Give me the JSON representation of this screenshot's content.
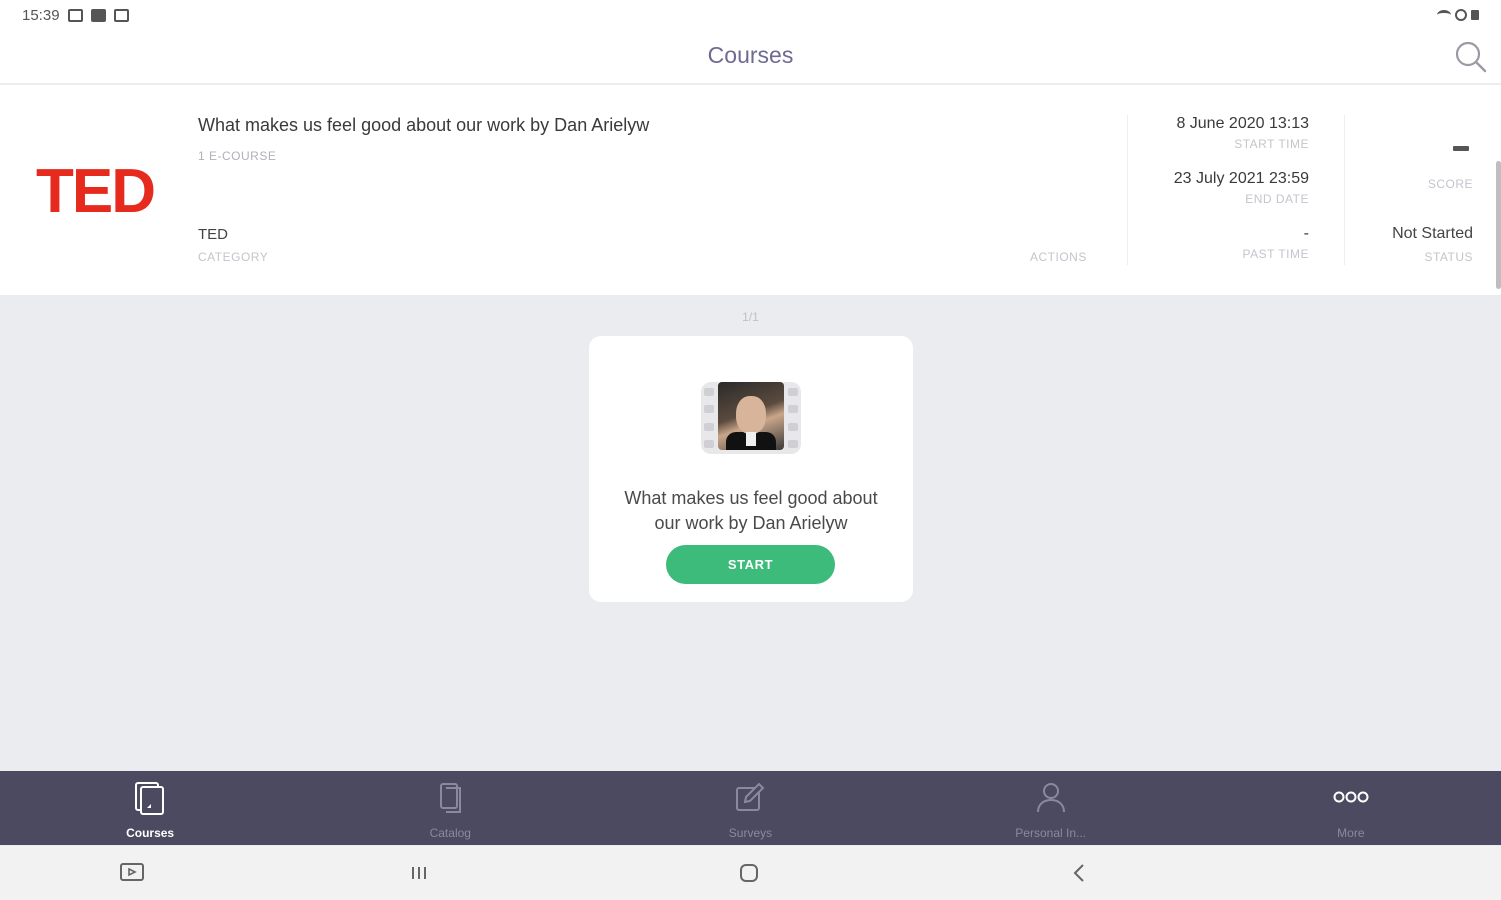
{
  "status_bar": {
    "time": "15:39"
  },
  "header": {
    "title": "Courses"
  },
  "course": {
    "logo_text": "TED",
    "title": "What makes us feel good about our work by Dan Arielyw",
    "type": "1 E-COURSE",
    "category_value": "TED",
    "category_label": "CATEGORY",
    "actions_label": "ACTIONS",
    "start_time_value": "8 June 2020 13:13",
    "start_time_label": "START TIME",
    "end_date_value": "23 July 2021 23:59",
    "end_date_label": "END DATE",
    "past_time_value": "-",
    "past_time_label": "PAST TIME",
    "score_label": "SCORE",
    "status_value": "Not Started",
    "status_label": "STATUS"
  },
  "pager": "1/1",
  "card": {
    "title": "What makes us feel good about our work by Dan Arielyw",
    "button_label": "START"
  },
  "bottom_nav": {
    "items": [
      {
        "label": "Courses",
        "icon": "courses-icon",
        "active": true
      },
      {
        "label": "Catalog",
        "icon": "catalog-icon",
        "active": false
      },
      {
        "label": "Surveys",
        "icon": "surveys-icon",
        "active": false
      },
      {
        "label": "Personal In...",
        "icon": "person-icon",
        "active": false
      },
      {
        "label": "More",
        "icon": "more-icon",
        "active": false
      }
    ]
  },
  "colors": {
    "header_title": "#6e6a92",
    "ted_red": "#e62b1e",
    "start_green": "#3dbb7a",
    "nav_bg": "#4b4a61"
  }
}
